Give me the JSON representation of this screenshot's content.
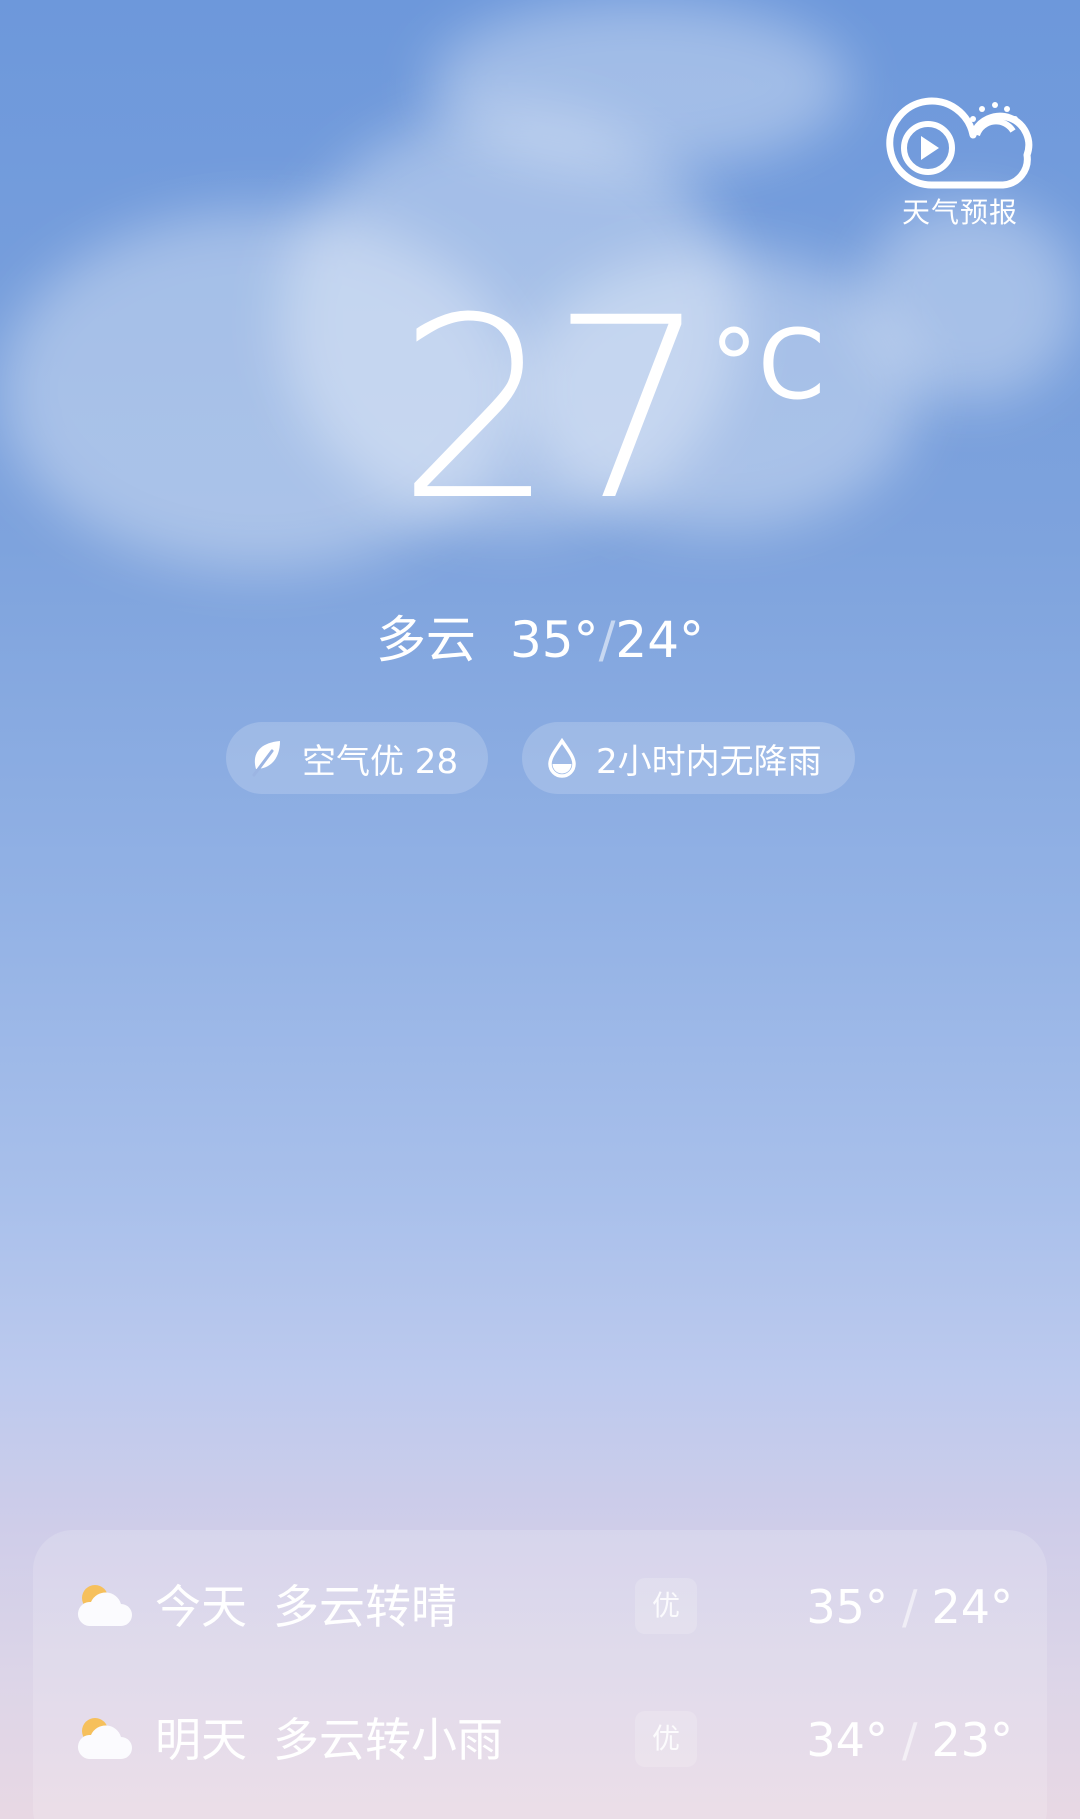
{
  "video_entry": {
    "icon": "play-cloud-sun-icon",
    "label": "天气预报"
  },
  "current": {
    "temperature": "27",
    "unit": "°C",
    "condition": "多云",
    "high": "35°",
    "separator": "/",
    "low": "24°"
  },
  "chips": {
    "air": {
      "icon": "leaf-icon",
      "label": "空气优 28"
    },
    "rain": {
      "icon": "water-drop-icon",
      "label": "2小时内无降雨"
    }
  },
  "forecast": [
    {
      "icon": "partly-cloudy-icon",
      "day": "今天",
      "desc": "多云转晴",
      "aqi": "优",
      "high": "35°",
      "separator": "/",
      "low": "24°"
    },
    {
      "icon": "partly-cloudy-icon",
      "day": "明天",
      "desc": "多云转小雨",
      "aqi": "优",
      "high": "34°",
      "separator": "/",
      "low": "23°"
    }
  ],
  "colors": {
    "sky_top": "#6d98db",
    "sky_bottom": "#e8d8e4",
    "sun": "#f6c05c"
  }
}
